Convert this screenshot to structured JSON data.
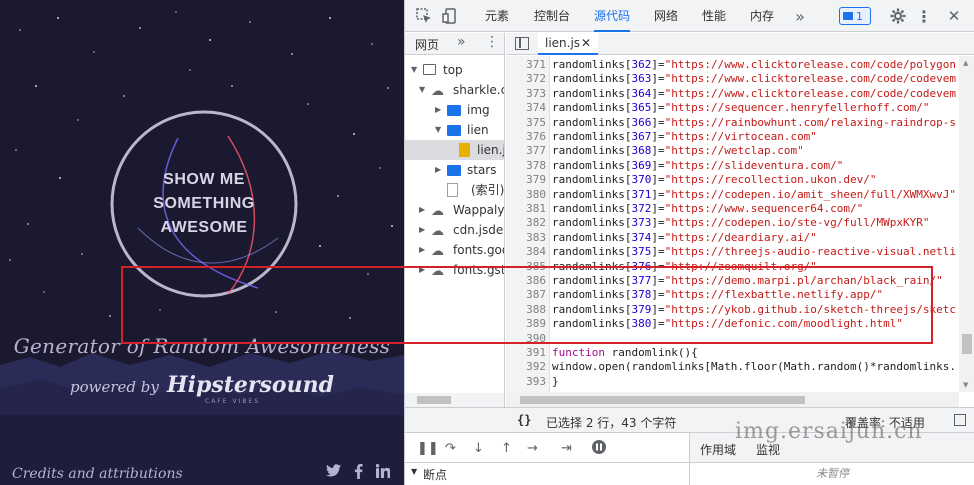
{
  "site": {
    "circle_lines": [
      "SHOW ME",
      "SOMETHING",
      "AWESOME"
    ],
    "title": "Generator of Random Awesomeness",
    "powered_by": "powered by",
    "brand": "Hipstersound",
    "brand_sub": "CAFE VIBES",
    "credits": "Credits and attributions",
    "social": {
      "twitter": "twitter-icon",
      "facebook": "facebook-icon",
      "linkedin": "linkedin-icon"
    }
  },
  "devtools": {
    "tabs": [
      "元素",
      "控制台",
      "源代码",
      "网络",
      "性能",
      "内存"
    ],
    "active_tab": "源代码",
    "more": "»",
    "badge_count": "1",
    "navigator": {
      "tab": "网页",
      "items": [
        {
          "label": "top",
          "icon": "frame-icon"
        },
        {
          "label": "sharkle.co",
          "icon": "cloud-icon"
        },
        {
          "label": "img",
          "icon": "folder-icon"
        },
        {
          "label": "lien",
          "icon": "folder-icon"
        },
        {
          "label": "lien.js",
          "icon": "file-icon"
        },
        {
          "label": "stars",
          "icon": "folder-icon"
        },
        {
          "label": "(索引)",
          "icon": "page-icon"
        },
        {
          "label": "Wappalyz",
          "icon": "cloud-icon"
        },
        {
          "label": "cdn.jsdeliv",
          "icon": "cloud-icon"
        },
        {
          "label": "fonts.goo",
          "icon": "cloud-icon"
        },
        {
          "label": "fonts.gsta",
          "icon": "cloud-icon"
        }
      ]
    },
    "file_tab": "lien.js",
    "code_lines": [
      {
        "ln": "371",
        "idx": "362",
        "url": "https://www.clicktorelease.com/code/polygon"
      },
      {
        "ln": "372",
        "idx": "363",
        "url": "https://www.clicktorelease.com/code/codevem"
      },
      {
        "ln": "373",
        "idx": "364",
        "url": "https://www.clicktorelease.com/code/codevem"
      },
      {
        "ln": "374",
        "idx": "365",
        "url": "https://sequencer.henryfellerhoff.com/\""
      },
      {
        "ln": "375",
        "idx": "366",
        "url": "https://rainbowhunt.com/relaxing-raindrop-s"
      },
      {
        "ln": "376",
        "idx": "367",
        "url": "https://virtocean.com\""
      },
      {
        "ln": "377",
        "idx": "368",
        "url": "https://wetclap.com\""
      },
      {
        "ln": "378",
        "idx": "369",
        "url": "https://slideventura.com/\""
      },
      {
        "ln": "379",
        "idx": "370",
        "url": "https://recollection.ukon.dev/\""
      },
      {
        "ln": "380",
        "idx": "371",
        "url": "https://codepen.io/amit_sheen/full/XWMXwvJ\""
      },
      {
        "ln": "381",
        "idx": "372",
        "url": "https://www.sequencer64.com/\""
      },
      {
        "ln": "382",
        "idx": "373",
        "url": "https://codepen.io/ste-vg/full/MWpxKYR\""
      },
      {
        "ln": "383",
        "idx": "374",
        "url": "https://deardiary.ai/\""
      },
      {
        "ln": "384",
        "idx": "375",
        "url": "https://threejs-audio-reactive-visual.netli"
      },
      {
        "ln": "385",
        "idx": "376",
        "url": "http://zoomquilt.org/\""
      },
      {
        "ln": "386",
        "idx": "377",
        "url": "https://demo.marpi.pl/archan/black_rain/\""
      },
      {
        "ln": "387",
        "idx": "378",
        "url": "https://flexbattle.netlify.app/\""
      },
      {
        "ln": "388",
        "idx": "379",
        "url": "https://ykob.github.io/sketch-threejs/sketc"
      },
      {
        "ln": "389",
        "idx": "380",
        "url": "https://defonic.com/moodlight.html\""
      }
    ],
    "code_tail": [
      {
        "ln": "390",
        "text": ""
      },
      {
        "ln": "391",
        "text": "function randomlink(){"
      },
      {
        "ln": "392",
        "text": "window.open(randomlinks[Math.floor(Math.random()*randomlinks."
      },
      {
        "ln": "393",
        "text": "}"
      }
    ],
    "status": {
      "braces": "{}",
      "selection": "已选择 2 行，43 个字符",
      "coverage": "覆盖率: 不适用"
    },
    "side_tabs": [
      "作用域",
      "监视"
    ],
    "breakpoints": "断点",
    "not_paused": "未暂停"
  },
  "watermark": "img.ersaijun.cn"
}
